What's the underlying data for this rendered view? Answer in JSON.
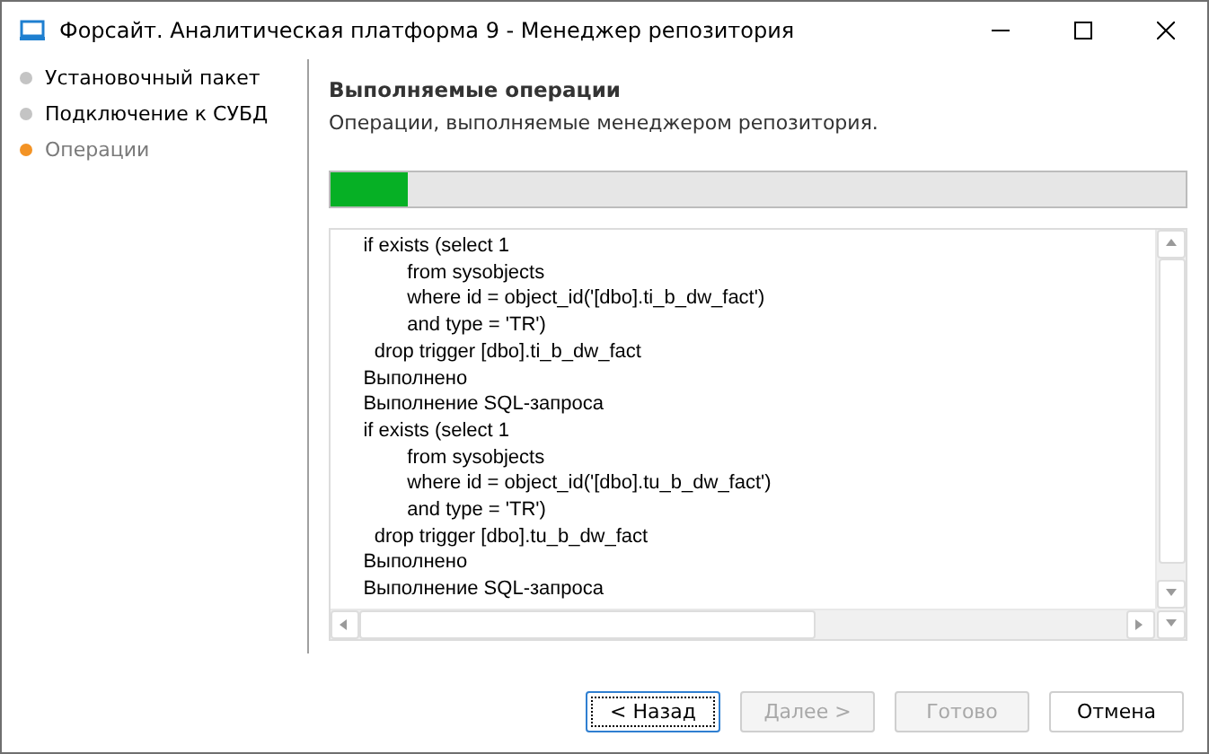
{
  "window": {
    "title": "Форсайт. Аналитическая платформа 9 - Менеджер репозитория"
  },
  "steps": [
    {
      "label": "Установочный пакет",
      "selected": false
    },
    {
      "label": "Подключение к СУБД",
      "selected": false
    },
    {
      "label": "Операции",
      "selected": true
    }
  ],
  "header": {
    "title": "Выполняемые операции",
    "subtitle": "Операции, выполняемые менеджером репозитория."
  },
  "progress": {
    "level": 0.09
  },
  "log": [
    "    if exists (select 1",
    "            from sysobjects",
    "            where id = object_id('[dbo].ti_b_dw_fact')",
    "            and type = 'TR')",
    "      drop trigger [dbo].ti_b_dw_fact",
    "    Выполнено",
    "    Выполнение SQL-запроса",
    "    if exists (select 1",
    "            from sysobjects",
    "            where id = object_id('[dbo].tu_b_dw_fact')",
    "            and type = 'TR')",
    "      drop trigger [dbo].tu_b_dw_fact",
    "    Выполнено",
    "    Выполнение SQL-запроса"
  ],
  "buttons": [
    {
      "label": "< Назад",
      "disabled": false,
      "focused": true
    },
    {
      "label": "Далее >",
      "disabled": true,
      "focused": false
    },
    {
      "label": "Готово",
      "disabled": true,
      "focused": false
    },
    {
      "label": "Отмена",
      "disabled": false,
      "focused": false
    }
  ]
}
